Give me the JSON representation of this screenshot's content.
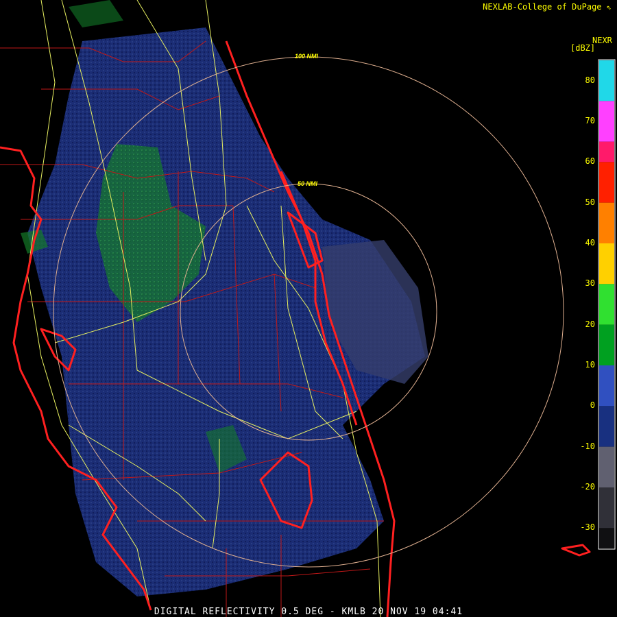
{
  "credit": "NEXLAB-College of DuPage",
  "credit_icon": "cursor-arrow-icon",
  "legend": {
    "product": "NEXR",
    "unit": "[dBZ]",
    "ticks": [
      "80",
      "70",
      "60",
      "50",
      "40",
      "30",
      "20",
      "10",
      "0",
      "-10",
      "-20",
      "-30"
    ],
    "tick_values": [
      80,
      70,
      60,
      50,
      40,
      30,
      20,
      10,
      0,
      -10,
      -20,
      -30
    ],
    "range": [
      -35,
      85
    ],
    "bands": [
      {
        "from": 75,
        "to": 85,
        "color": "#20d8e8"
      },
      {
        "from": 65,
        "to": 75,
        "color": "#ff40ff"
      },
      {
        "from": 60,
        "to": 65,
        "color": "#ff1a6a"
      },
      {
        "from": 50,
        "to": 60,
        "color": "#ff2000"
      },
      {
        "from": 40,
        "to": 50,
        "color": "#ff8000"
      },
      {
        "from": 30,
        "to": 40,
        "color": "#ffd000"
      },
      {
        "from": 20,
        "to": 30,
        "color": "#30e030"
      },
      {
        "from": 10,
        "to": 20,
        "color": "#00a020"
      },
      {
        "from": 0,
        "to": 10,
        "color": "#3050c0"
      },
      {
        "from": -10,
        "to": 0,
        "color": "#183080"
      },
      {
        "from": -20,
        "to": -10,
        "color": "#606070"
      },
      {
        "from": -30,
        "to": -20,
        "color": "#303038"
      },
      {
        "from": -35,
        "to": -30,
        "color": "#101012"
      }
    ]
  },
  "range_rings": [
    {
      "label": "100 NMI",
      "nmi": 100
    },
    {
      "label": "50 NMI",
      "nmi": 50
    }
  ],
  "caption": "DIGITAL REFLECTIVITY 0.5 DEG - KMLB 20 NOV 19 04:41",
  "colors": {
    "coastline": "#ff2020",
    "county_lines": "#c01818",
    "roads": "#e8f060",
    "range_rings": "#e0b090",
    "background": "#000000",
    "text": "#ffff00"
  }
}
